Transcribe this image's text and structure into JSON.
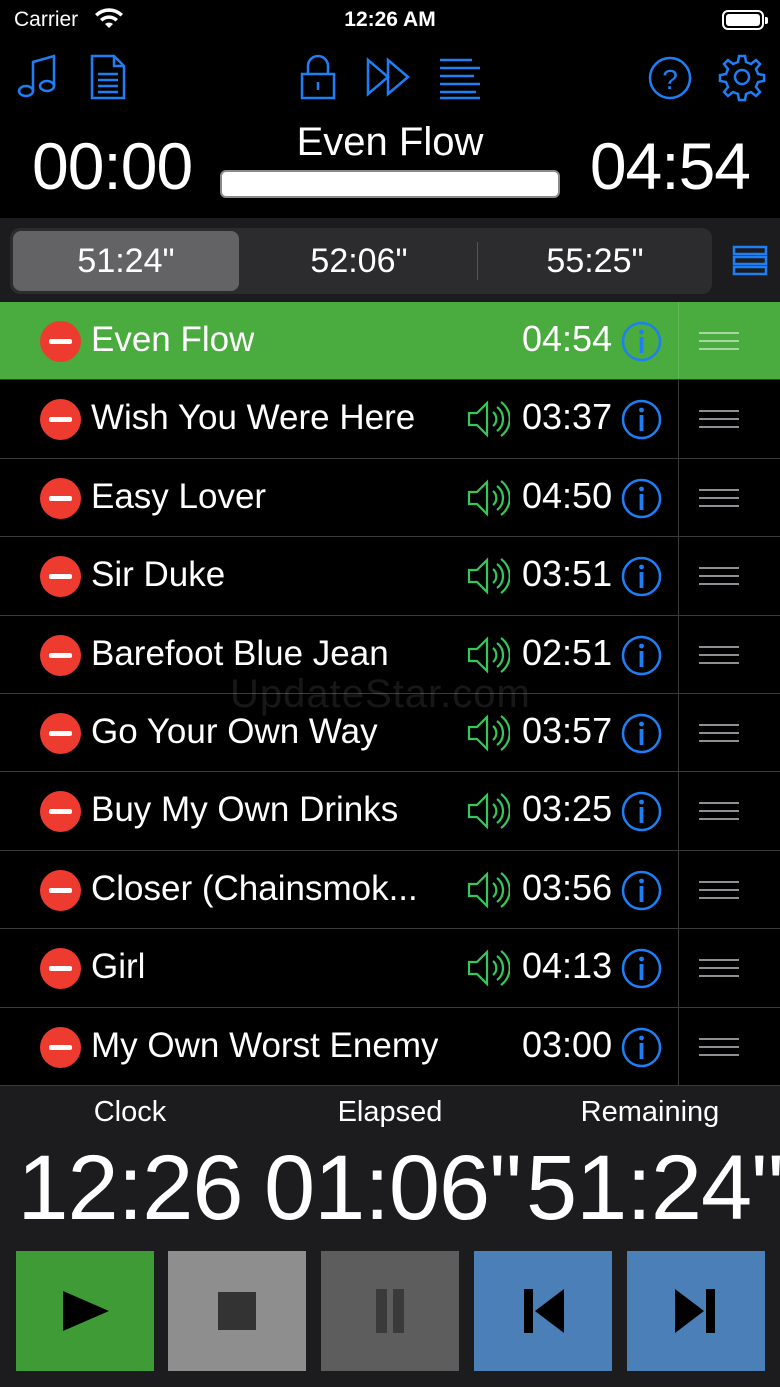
{
  "status_bar": {
    "carrier": "Carrier",
    "time": "12:26 AM"
  },
  "now_playing": {
    "elapsed": "00:00",
    "title": "Even Flow",
    "duration": "04:54",
    "progress": 0
  },
  "totals": {
    "segments": [
      "51:24\"",
      "52:06\"",
      "55:25\""
    ],
    "selected_index": 0
  },
  "songs": [
    {
      "title": "Even Flow",
      "duration": "04:54",
      "has_audio": false,
      "current": true
    },
    {
      "title": "Wish You Were Here",
      "duration": "03:37",
      "has_audio": true
    },
    {
      "title": "Easy Lover",
      "duration": "04:50",
      "has_audio": true
    },
    {
      "title": "Sir Duke",
      "duration": "03:51",
      "has_audio": true
    },
    {
      "title": "Barefoot Blue Jean",
      "duration": "02:51",
      "has_audio": true
    },
    {
      "title": "Go Your Own Way",
      "duration": "03:57",
      "has_audio": true
    },
    {
      "title": "Buy My Own Drinks",
      "duration": "03:25",
      "has_audio": true
    },
    {
      "title": "Closer (Chainsmok...",
      "duration": "03:56",
      "has_audio": true
    },
    {
      "title": "Girl",
      "duration": "04:13",
      "has_audio": true
    },
    {
      "title": "My Own Worst Enemy",
      "duration": "03:00",
      "has_audio": false
    }
  ],
  "watermark": "UpdateStar.com",
  "stats": {
    "clock_label": "Clock",
    "clock_value": "12:26",
    "elapsed_label": "Elapsed",
    "elapsed_value": "01:06\"",
    "remaining_label": "Remaining",
    "remaining_value": "51:24\""
  },
  "icons": {
    "toolbar_left": [
      "music-note-icon",
      "document-icon"
    ],
    "toolbar_center": [
      "lock-icon",
      "fast-forward-icon",
      "lines-icon"
    ],
    "toolbar_right": [
      "help-icon",
      "gear-icon"
    ]
  },
  "colors": {
    "accent_blue": "#1e7ff5",
    "current_row": "#4aab3f",
    "delete_red": "#ee3b30",
    "speaker_green": "#34c759",
    "play_green": "#3e9b35",
    "stop_gray": "#8e8e8e",
    "skip_blue": "#4a7fb8"
  }
}
